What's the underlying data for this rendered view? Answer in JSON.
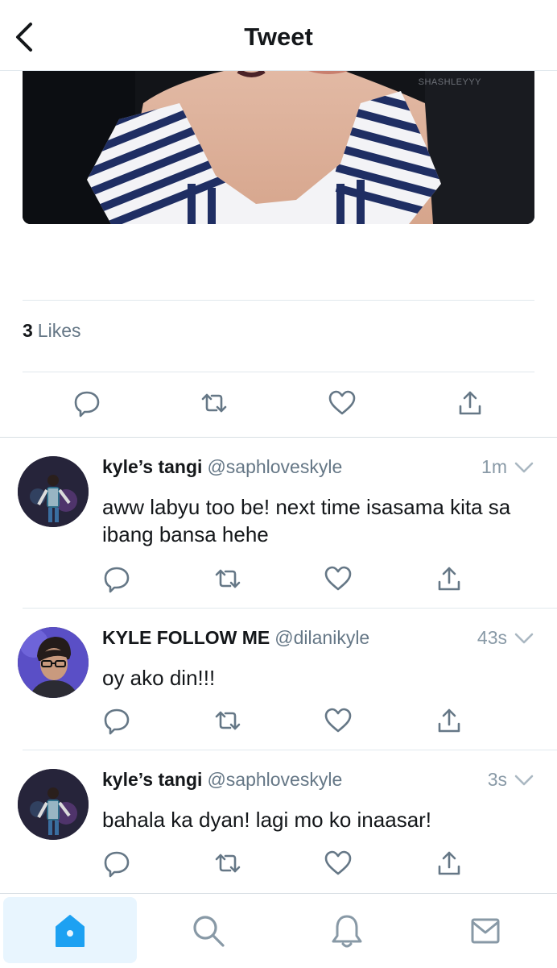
{
  "header": {
    "title": "Tweet",
    "back_icon": "chevron-left-icon"
  },
  "photo": {
    "watermark": "SHASHLEYYY"
  },
  "likes": {
    "count": "3",
    "label": "Likes"
  },
  "replies": [
    {
      "name": "kyle’s tangi",
      "handle": "@saphloveskyle",
      "time": "1m",
      "text": "aww labyu too be! next time isasama kita sa ibang bansa hehe"
    },
    {
      "name": "KYLE FOLLOW ME",
      "handle": "@dilanikyle",
      "time": "43s",
      "text": "oy ako din!!!"
    },
    {
      "name": "kyle’s tangi",
      "handle": "@saphloveskyle",
      "time": "3s",
      "text": "bahala ka dyan! lagi mo ko inaasar!"
    }
  ],
  "tabs": [
    {
      "icon": "home-icon",
      "active": true
    },
    {
      "icon": "search-icon",
      "active": false
    },
    {
      "icon": "notifications-icon",
      "active": false
    },
    {
      "icon": "messages-icon",
      "active": false
    }
  ],
  "colors": {
    "accent": "#1da1f2",
    "icon_gray": "#657786",
    "text": "#14171a",
    "secondary": "#657786",
    "divider": "#e1e8ed"
  }
}
